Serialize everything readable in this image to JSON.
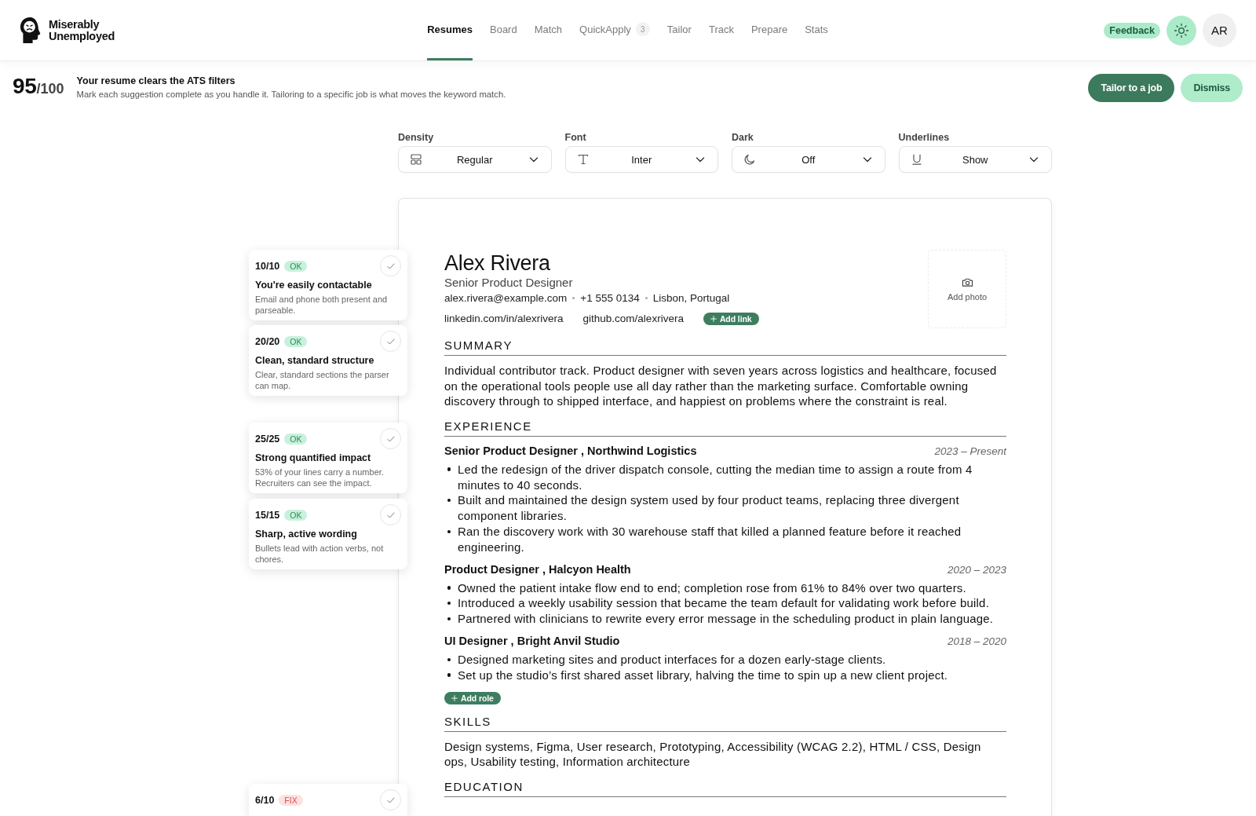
{
  "header": {
    "brand": "Miserably Unemployed",
    "nav": [
      {
        "label": "Resumes",
        "selected": true
      },
      {
        "label": "Board",
        "selected": false
      },
      {
        "label": "Match",
        "selected": false
      },
      {
        "label": "QuickApply",
        "count": "3",
        "selected": false
      },
      {
        "label": "Tailor",
        "selected": false
      },
      {
        "label": "Track",
        "selected": false
      },
      {
        "label": "Prepare",
        "selected": false
      },
      {
        "label": "Stats",
        "selected": false
      }
    ],
    "feedback": "Feedback",
    "avatar": "AR"
  },
  "score_banner": {
    "score": "95",
    "out_of": "/100",
    "title": "Your resume clears the ATS filters",
    "message": "Mark each suggestion complete as you handle it. Tailoring to a specific job is what moves the keyword match.",
    "buttons": [
      {
        "label": "Tailor to a job",
        "kind": "primary"
      },
      {
        "label": "Dismiss",
        "kind": "secondary"
      }
    ]
  },
  "display_options": [
    {
      "label": "Density",
      "value": "Regular"
    },
    {
      "label": "Font",
      "value": "Inter"
    },
    {
      "label": "Dark",
      "value": "Off"
    },
    {
      "label": "Underlines",
      "value": "Show"
    }
  ],
  "checks": [
    {
      "score": "10/10",
      "badge": "OK",
      "kind": "ok",
      "title": "You're easily contactable",
      "description": "Email and phone both present and parseable."
    },
    {
      "score": "20/20",
      "badge": "OK",
      "kind": "ok",
      "title": "Clean, standard structure",
      "description": "Clear, standard sections the parser can map."
    },
    {
      "score": "25/25",
      "badge": "OK",
      "kind": "ok",
      "title": "Strong quantified impact",
      "description": "53% of your lines carry a number. Recruiters can see the impact."
    },
    {
      "score": "15/15",
      "badge": "OK",
      "kind": "ok",
      "title": "Sharp, active wording",
      "description": "Bullets lead with action verbs, not chores."
    },
    {
      "score": "6/10",
      "badge": "FIX",
      "kind": "fix"
    }
  ],
  "resume": {
    "name": "Alex Rivera",
    "headline": "Senior Product Designer",
    "contact": [
      "alex.rivera@example.com",
      "+1 555 0134",
      "Lisbon, Portugal"
    ],
    "links": [
      "linkedin.com/in/alexrivera",
      "github.com/alexrivera"
    ],
    "add_link": "Add link",
    "photo": "Add photo",
    "sections": [
      {
        "kind": "text",
        "heading": "SUMMARY",
        "text": "Individual contributor track. Product designer with seven years across logistics and healthcare, focused on the operational tools people use all day rather than the marketing surface. Comfortable owning discovery through to shipped interface, and happiest on problems where the constraint is real."
      },
      {
        "kind": "jobs",
        "heading": "EXPERIENCE",
        "jobs": [
          {
            "title": "Senior Product Designer , Northwind Logistics",
            "dates": "2023 – Present",
            "bullets": [
              "Led the redesign of the driver dispatch console, cutting the median time to assign a route from 4 minutes to 40 seconds.",
              "Built and maintained the design system used by four product teams, replacing three divergent component libraries.",
              "Ran the discovery work with 30 warehouse staff that killed a planned feature before it reached engineering."
            ]
          },
          {
            "title": "Product Designer , Halcyon Health",
            "dates": "2020 – 2023",
            "bullets": [
              "Owned the patient intake flow end to end; completion rose from 61% to 84% over two quarters.",
              "Introduced a weekly usability session that became the team default for validating work before build.",
              "Partnered with clinicians to rewrite every error message in the scheduling product in plain language."
            ]
          },
          {
            "title": "UI Designer , Bright Anvil Studio",
            "dates": "2018 – 2020",
            "bullets": [
              "Designed marketing sites and product interfaces for a dozen early-stage clients.",
              "Set up the studio’s first shared asset library, halving the time to spin up a new client project."
            ]
          }
        ],
        "add_button": "Add role"
      },
      {
        "kind": "text",
        "heading": "SKILLS",
        "text": "Design systems, Figma, User research, Prototyping, Accessibility (WCAG 2.2), HTML / CSS, Design ops, Usability testing, Information architecture"
      },
      {
        "kind": "text",
        "heading": "EDUCATION"
      }
    ]
  }
}
